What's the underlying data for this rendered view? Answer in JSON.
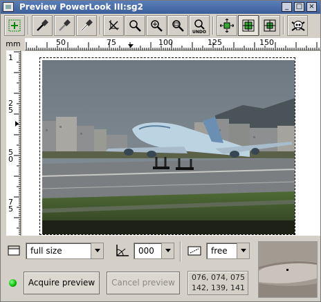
{
  "window": {
    "title": "Preview PowerLook III:sg2",
    "min_label": "_",
    "max_label": "□",
    "close_label": "×"
  },
  "toolbar": {
    "tools": [
      {
        "name": "select-area-tool",
        "icon": "plus-frame-icon"
      },
      {
        "name": "black-point-tool",
        "icon": "eyedropper-black-icon"
      },
      {
        "name": "gray-point-tool",
        "icon": "eyedropper-gray-icon"
      },
      {
        "name": "white-point-tool",
        "icon": "eyedropper-white-icon"
      },
      {
        "name": "auto-crop-tool",
        "icon": "no-crop-icon"
      },
      {
        "name": "zoom-tool",
        "icon": "magnifier-icon"
      },
      {
        "name": "zoom-in-tool",
        "icon": "magnifier-plus-icon"
      },
      {
        "name": "zoom-fit-tool",
        "icon": "magnifier-frame-icon"
      },
      {
        "name": "zoom-undo-tool",
        "icon": "magnifier-undo-icon",
        "label": "UNDO"
      },
      {
        "name": "full-preview-tool",
        "icon": "expand-arrows-icon"
      },
      {
        "name": "center-tool",
        "icon": "crosshair-square-icon"
      },
      {
        "name": "fit-window-tool",
        "icon": "compress-arrows-icon"
      },
      {
        "name": "delete-preview-tool",
        "icon": "skull-crossbones-icon"
      }
    ]
  },
  "ruler": {
    "unit": "mm",
    "h_labels": [
      "50",
      "75",
      "100",
      "125",
      "150"
    ],
    "v_labels": [
      "1",
      "2\n5",
      "5\n0",
      "7\n5"
    ]
  },
  "controls": {
    "preview_size": "full size",
    "rotation": "000",
    "aspect": "free"
  },
  "buttons": {
    "acquire": "Acquire preview",
    "cancel": "Cancel preview"
  },
  "pixel_info": {
    "line1": "076, 074, 075",
    "line2": "142, 139, 141"
  },
  "status": {
    "led_color": "#00bb00"
  }
}
